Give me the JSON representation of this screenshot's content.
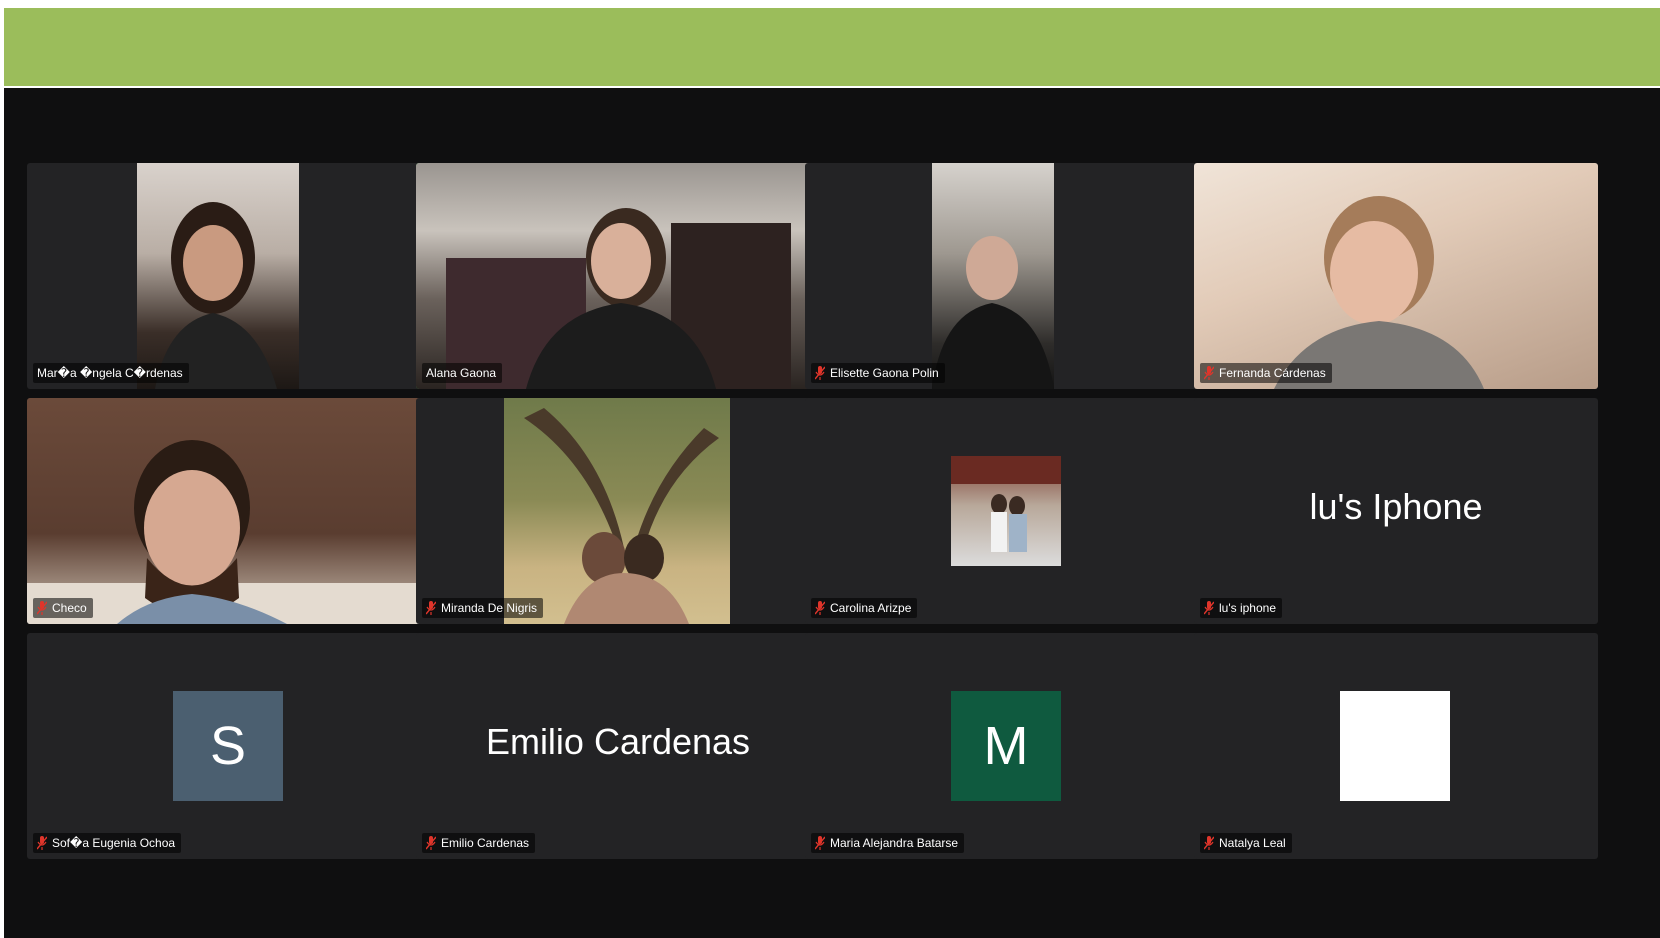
{
  "colors": {
    "banner": "#9bbd5b",
    "background": "#0f0f10",
    "tile": "#232325",
    "active_speaker_border": "#39b94a",
    "mute_icon": "#e0352b"
  },
  "participants": [
    {
      "label": "Mar�a �ngela C�rdenas",
      "muted": false,
      "type": "video"
    },
    {
      "label": "Alana Gaona",
      "muted": false,
      "type": "video",
      "active_speaker": true
    },
    {
      "label": "Elisette Gaona Polin",
      "muted": true,
      "type": "video"
    },
    {
      "label": "Fernanda Cárdenas",
      "muted": true,
      "type": "video"
    },
    {
      "label": "Checo",
      "muted": true,
      "type": "video"
    },
    {
      "label": "Miranda De Nigris",
      "muted": true,
      "type": "video"
    },
    {
      "label": "Carolina Arizpe",
      "muted": true,
      "type": "profile-photo"
    },
    {
      "label": "lu's iphone",
      "muted": true,
      "type": "name",
      "display_name": "lu's Iphone"
    },
    {
      "label": "Sof�a Eugenia Ochoa",
      "muted": true,
      "type": "avatar",
      "initial": "S",
      "avatar_color": "#4b5f70"
    },
    {
      "label": "Emilio Cardenas",
      "muted": true,
      "type": "name",
      "display_name": "Emilio Cardenas"
    },
    {
      "label": "Maria Alejandra Batarse",
      "muted": true,
      "type": "avatar",
      "initial": "M",
      "avatar_color": "#0f5a3f"
    },
    {
      "label": "Natalya Leal",
      "muted": true,
      "type": "profile-photo-blank"
    }
  ]
}
